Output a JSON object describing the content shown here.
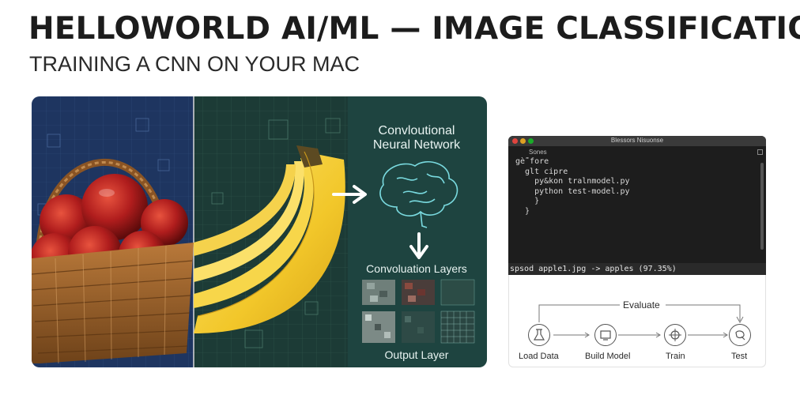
{
  "title": "HELLOWORLD AI/ML — IMAGE CLASSIFICATION",
  "subtitle": "TRAINING A CNN ON YOUR MAC",
  "hero": {
    "network_title_line1": "Convloutional",
    "network_title_line2": "Neural Network",
    "conv_layers_label": "Convoluation Layers",
    "output_layer_label": "Output Layer"
  },
  "terminal": {
    "window_title": "Blessors Nisuonse",
    "tab_label": "Sones",
    "lines": [
      "gè̄̃̄ fore",
      "  glt cipre",
      "    py&kon tralnmodel.py",
      "    python test-model.py",
      "    }",
      "  }"
    ],
    "status": "spsod apple1.jpg -> apples (97.35%)"
  },
  "workflow": {
    "loop_label": "Evaluate",
    "steps": [
      "Load Data",
      "Build Model",
      "Train",
      "Test"
    ]
  },
  "colors": {
    "hero_left_bg": "#1e3560",
    "hero_mid_bg": "#1c3b36",
    "hero_right_bg": "#1e4440",
    "terminal_bg": "#1d1d1d",
    "brain_glow": "#7fe3e8"
  }
}
